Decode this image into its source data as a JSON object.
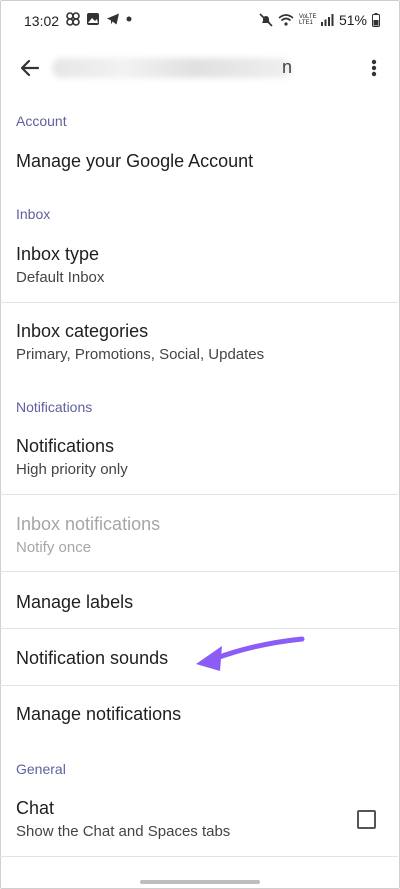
{
  "status_bar": {
    "time": "13:02",
    "battery": "51%",
    "network_label": "VoLTE LTE1"
  },
  "app_bar": {
    "account_email_tail": "n"
  },
  "sections": {
    "account": {
      "header": "Account",
      "manage_account": "Manage your Google Account"
    },
    "inbox": {
      "header": "Inbox",
      "inbox_type": {
        "title": "Inbox type",
        "subtitle": "Default Inbox"
      },
      "inbox_categories": {
        "title": "Inbox categories",
        "subtitle": "Primary, Promotions, Social, Updates"
      }
    },
    "notifications": {
      "header": "Notifications",
      "notifications": {
        "title": "Notifications",
        "subtitle": "High priority only"
      },
      "inbox_notifications": {
        "title": "Inbox notifications",
        "subtitle": "Notify once"
      },
      "manage_labels": "Manage labels",
      "notification_sounds": "Notification sounds",
      "manage_notifications": "Manage notifications"
    },
    "general": {
      "header": "General",
      "chat": {
        "title": "Chat",
        "subtitle": "Show the Chat and Spaces tabs",
        "checked": false
      }
    }
  },
  "colors": {
    "section_header": "#5f5f9f",
    "annotation_arrow": "#8b5cf6"
  }
}
